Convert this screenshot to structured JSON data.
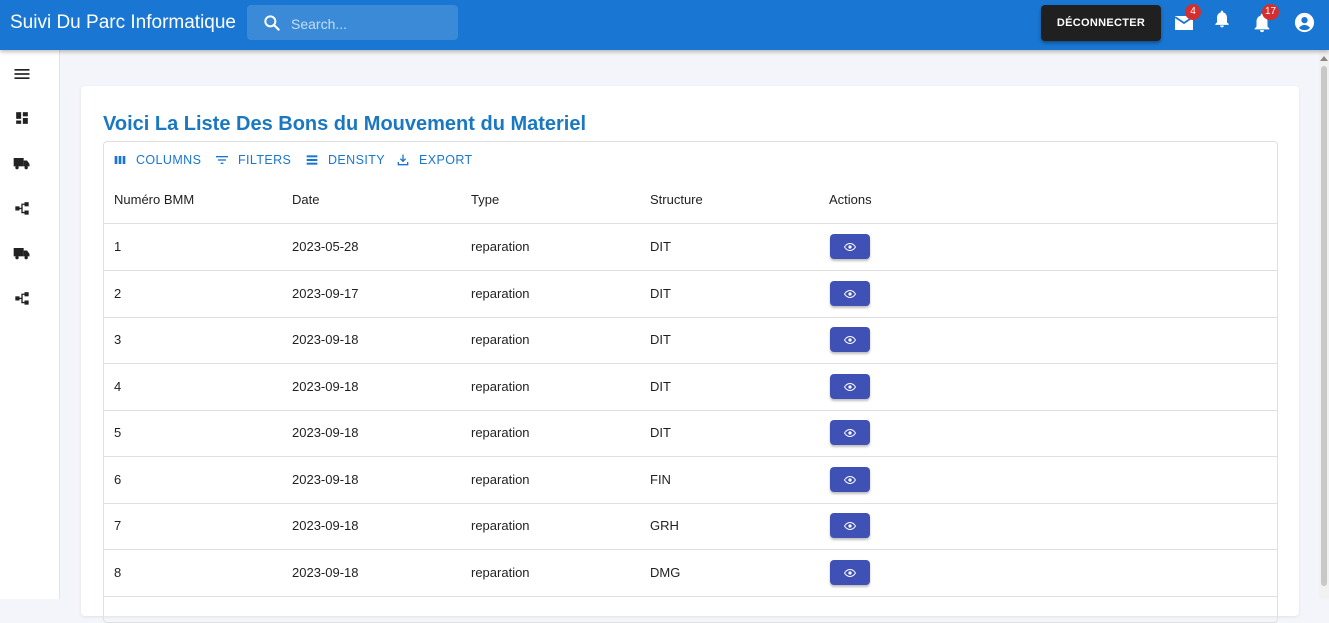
{
  "app": {
    "title": "Suivi Du Parc Informatique"
  },
  "search": {
    "placeholder": "Search..."
  },
  "header": {
    "logout_label": "DÉCONNECTER",
    "mail_badge": "4",
    "notifications_badge": "17",
    "icons": [
      "mail-icon",
      "bell-icon",
      "notifications-icon",
      "account-circle-icon"
    ]
  },
  "sidebar": {
    "icons": [
      "menu-icon",
      "dashboard-icon",
      "truck-icon",
      "hierarchy-icon",
      "truck-icon",
      "hierarchy-icon"
    ]
  },
  "page": {
    "title": "Voici La Liste Des Bons du Mouvement du Materiel"
  },
  "toolbar": {
    "columns": "COLUMNS",
    "filters": "FILTERS",
    "density": "DENSITY",
    "export": "EXPORT"
  },
  "table": {
    "columns": [
      "Numéro BMM",
      "Date",
      "Type",
      "Structure",
      "Actions"
    ],
    "rows": [
      {
        "numero": "1",
        "date": "2023-05-28",
        "type": "reparation",
        "structure": "DIT"
      },
      {
        "numero": "2",
        "date": "2023-09-17",
        "type": "reparation",
        "structure": "DIT"
      },
      {
        "numero": "3",
        "date": "2023-09-18",
        "type": "reparation",
        "structure": "DIT"
      },
      {
        "numero": "4",
        "date": "2023-09-18",
        "type": "reparation",
        "structure": "DIT"
      },
      {
        "numero": "5",
        "date": "2023-09-18",
        "type": "reparation",
        "structure": "DIT"
      },
      {
        "numero": "6",
        "date": "2023-09-18",
        "type": "reparation",
        "structure": "FIN"
      },
      {
        "numero": "7",
        "date": "2023-09-18",
        "type": "reparation",
        "structure": "GRH"
      },
      {
        "numero": "8",
        "date": "2023-09-18",
        "type": "reparation",
        "structure": "DMG"
      }
    ]
  },
  "colors": {
    "appbar": "#1976d2",
    "title": "#1a78c2",
    "action_button": "#3f51b5",
    "badge": "#d32f2f"
  }
}
